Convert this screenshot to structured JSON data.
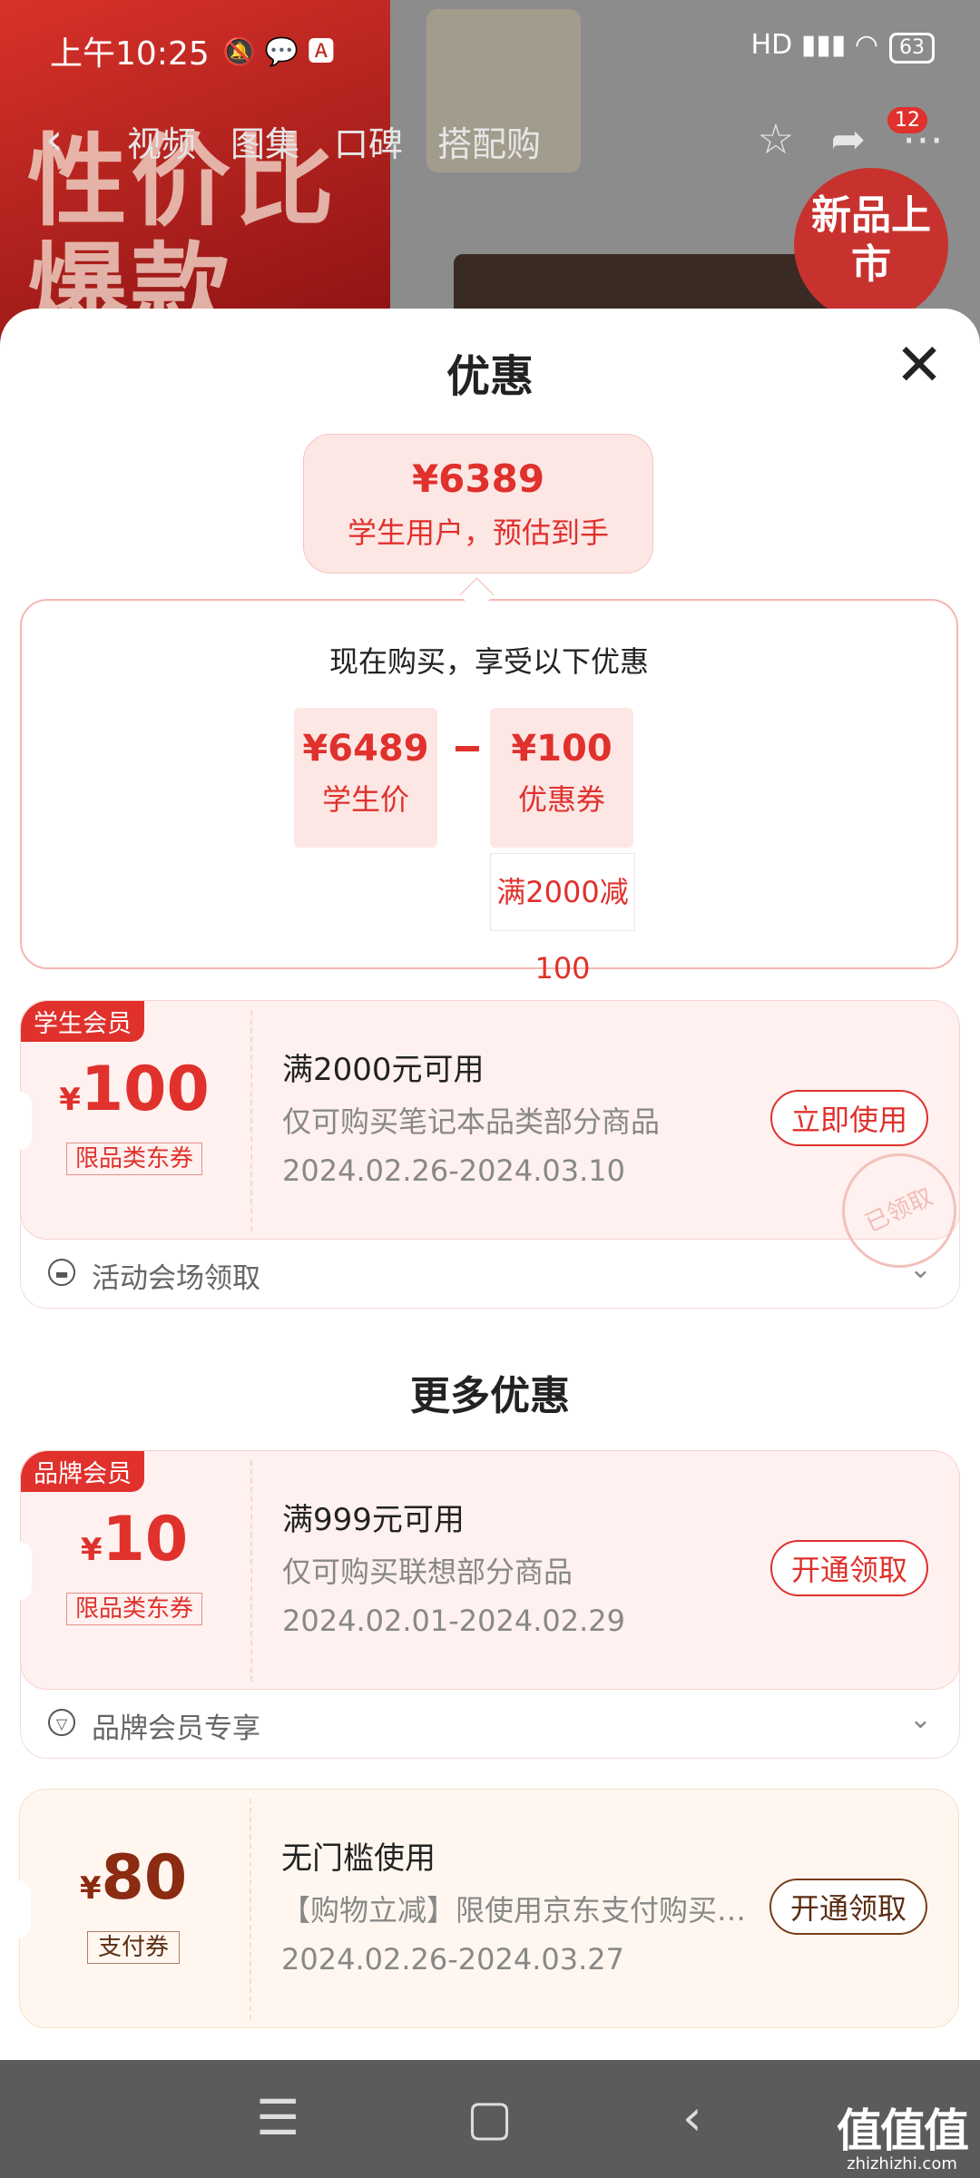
{
  "status_bar": {
    "time": "上午10:25",
    "battery": "63",
    "network": "HD"
  },
  "top_nav": {
    "tabs": [
      "视频",
      "图集",
      "口碑",
      "搭配购"
    ],
    "badge_count": "12"
  },
  "background": {
    "promo_text": "性价比爆款",
    "new_badge": "新品上市"
  },
  "sheet": {
    "title": "优惠",
    "estimate": {
      "price": "¥6389",
      "label": "学生用户，预估到手"
    },
    "calc": {
      "title": "现在购买，享受以下优惠",
      "student_price": {
        "value": "¥6489",
        "label": "学生价"
      },
      "minus": "−",
      "coupon": {
        "value": "¥100",
        "label": "优惠券",
        "condition": "满2000减100"
      }
    }
  },
  "coupons": [
    {
      "tag": "学生会员",
      "currency": "¥",
      "amount": "100",
      "type": "限品类东券",
      "title": "满2000元可用",
      "subtitle": "仅可购买笔记本品类部分商品",
      "date": "2024.02.26-2024.03.10",
      "button": "立即使用",
      "stamp": "已领取",
      "footer": "活动会场领取"
    },
    {
      "tag": "品牌会员",
      "currency": "¥",
      "amount": "10",
      "type": "限品类东券",
      "title": "满999元可用",
      "subtitle": "仅可购买联想部分商品",
      "date": "2024.02.01-2024.02.29",
      "button": "开通领取",
      "footer": "品牌会员专享"
    },
    {
      "currency": "¥",
      "amount": "80",
      "type": "支付券",
      "title": "无门槛使用",
      "subtitle": "【购物立减】限使用京东支付购买指定商品",
      "date": "2024.02.26-2024.03.27",
      "button": "开通领取"
    }
  ],
  "more_title": "更多优惠",
  "watermark": {
    "main": "值值值",
    "sub": "zhizhizhi.com"
  },
  "colors": {
    "accent": "#e0312c",
    "coupon_red_bg": "#fef1ef",
    "coupon_orange_bg": "#fff7ef",
    "brown": "#5a2d12"
  }
}
